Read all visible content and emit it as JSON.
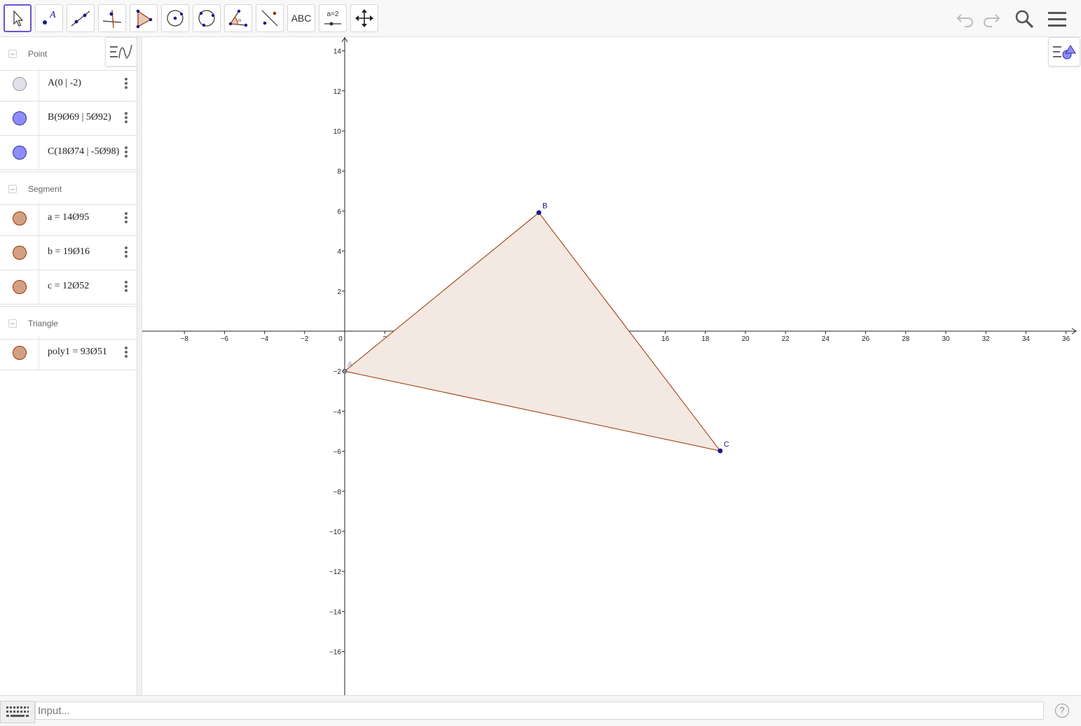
{
  "toolbar": {
    "tools": [
      {
        "name": "move-tool",
        "icon": "cursor-arrow-icon"
      },
      {
        "name": "point-tool",
        "icon": "point-icon",
        "label": "A"
      },
      {
        "name": "line-tool",
        "icon": "line-through-two-points-icon"
      },
      {
        "name": "perpendicular-line-tool",
        "icon": "perpendicular-line-icon"
      },
      {
        "name": "polygon-tool",
        "icon": "polygon-icon"
      },
      {
        "name": "circle-tool",
        "icon": "circle-center-point-icon"
      },
      {
        "name": "circle-three-points-tool",
        "icon": "circle-three-points-icon"
      },
      {
        "name": "angle-tool",
        "icon": "angle-icon",
        "label": "α"
      },
      {
        "name": "reflect-tool",
        "icon": "reflect-about-line-icon"
      },
      {
        "name": "text-tool",
        "icon": "text-icon",
        "label": "ABC"
      },
      {
        "name": "slider-tool",
        "icon": "slider-icon",
        "label": "a=2"
      },
      {
        "name": "move-graphics-tool",
        "icon": "move-graphics-view-icon"
      }
    ],
    "right": {
      "undo": "undo-icon",
      "redo": "redo-icon",
      "search": "search-icon",
      "menu": "hamburger-menu-icon"
    }
  },
  "algebra": {
    "groups": [
      {
        "title": "Point",
        "items": [
          {
            "value": "A(0 | -2)",
            "color": "#e0e0e8"
          },
          {
            "value": "B(9Ø69 | 5Ø92)",
            "color": "#8c8cff"
          },
          {
            "value": "C(18Ø74 | -5Ø98)",
            "color": "#8c8cff"
          }
        ]
      },
      {
        "title": "Segment",
        "items": [
          {
            "value": "a = 14Ø95",
            "color": "#d2a184"
          },
          {
            "value": "b = 19Ø16",
            "color": "#d2a184"
          },
          {
            "value": "c = 12Ø52",
            "color": "#d2a184"
          }
        ]
      },
      {
        "title": "Triangle",
        "items": [
          {
            "value": "poly1 = 93Ø51",
            "color": "#d2a184"
          }
        ]
      }
    ]
  },
  "graphics": {
    "x_ticks": [
      "-8",
      "-6",
      "-4",
      "-2",
      "0",
      "2",
      "4",
      "6",
      "8",
      "10",
      "12",
      "14",
      "16",
      "18",
      "20",
      "22",
      "24",
      "26",
      "28",
      "30",
      "32",
      "34",
      "36"
    ],
    "y_ticks": [
      "14",
      "12",
      "10",
      "8",
      "6",
      "4",
      "2",
      "-2",
      "-4",
      "-6",
      "-8",
      "-10",
      "-12",
      "-14",
      "-16"
    ],
    "points": [
      {
        "label": "A",
        "x": 0,
        "y": -2
      },
      {
        "label": "B",
        "x": 9.69,
        "y": 5.92
      },
      {
        "label": "C",
        "x": 18.74,
        "y": -5.98
      }
    ],
    "triangle_fill": "#f3e8e2",
    "triangle_stroke": "#993300",
    "point_color": "#1a1a8c"
  },
  "input": {
    "placeholder": "Input...",
    "help": "?"
  }
}
